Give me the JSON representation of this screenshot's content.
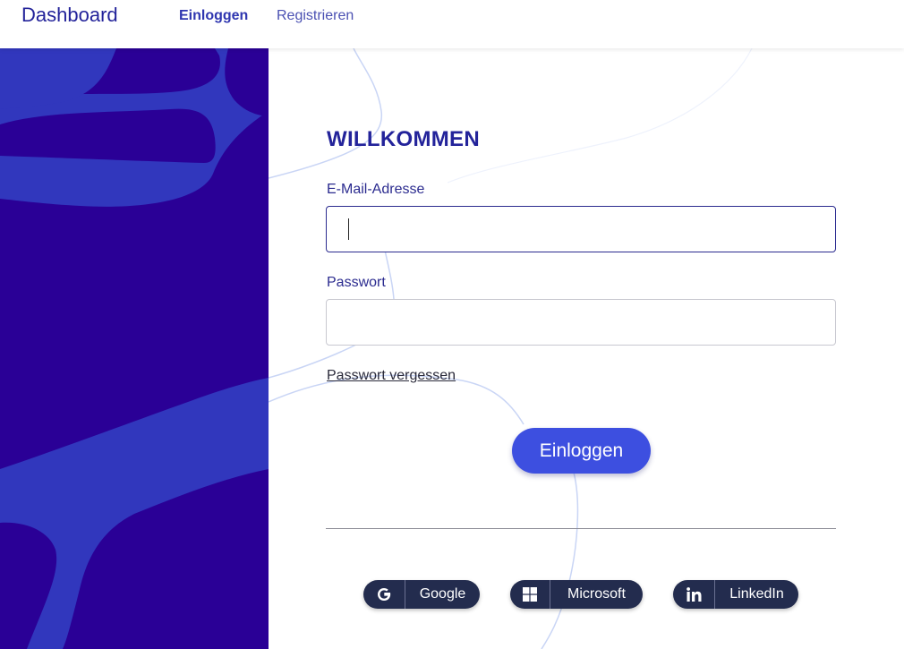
{
  "header": {
    "brand": "Dashboard",
    "nav": {
      "login": "Einloggen",
      "register": "Registrieren"
    }
  },
  "form": {
    "title": "WILLKOMMEN",
    "email_label": "E-Mail-Adresse",
    "email_value": "",
    "password_label": "Passwort",
    "password_value": "",
    "forgot_link": "Passwort vergessen",
    "submit_label": "Einloggen"
  },
  "social": {
    "google": {
      "label": "Google",
      "icon": "google-icon"
    },
    "microsoft": {
      "label": "Microsoft",
      "icon": "microsoft-icon"
    },
    "linkedin": {
      "label": "LinkedIn",
      "icon": "linkedin-icon"
    }
  },
  "colors": {
    "primary": "#23239a",
    "panel": "#2a0096",
    "panel_shape": "#3137bd",
    "button": "#3d4fe0",
    "social_button": "#232c4e"
  }
}
